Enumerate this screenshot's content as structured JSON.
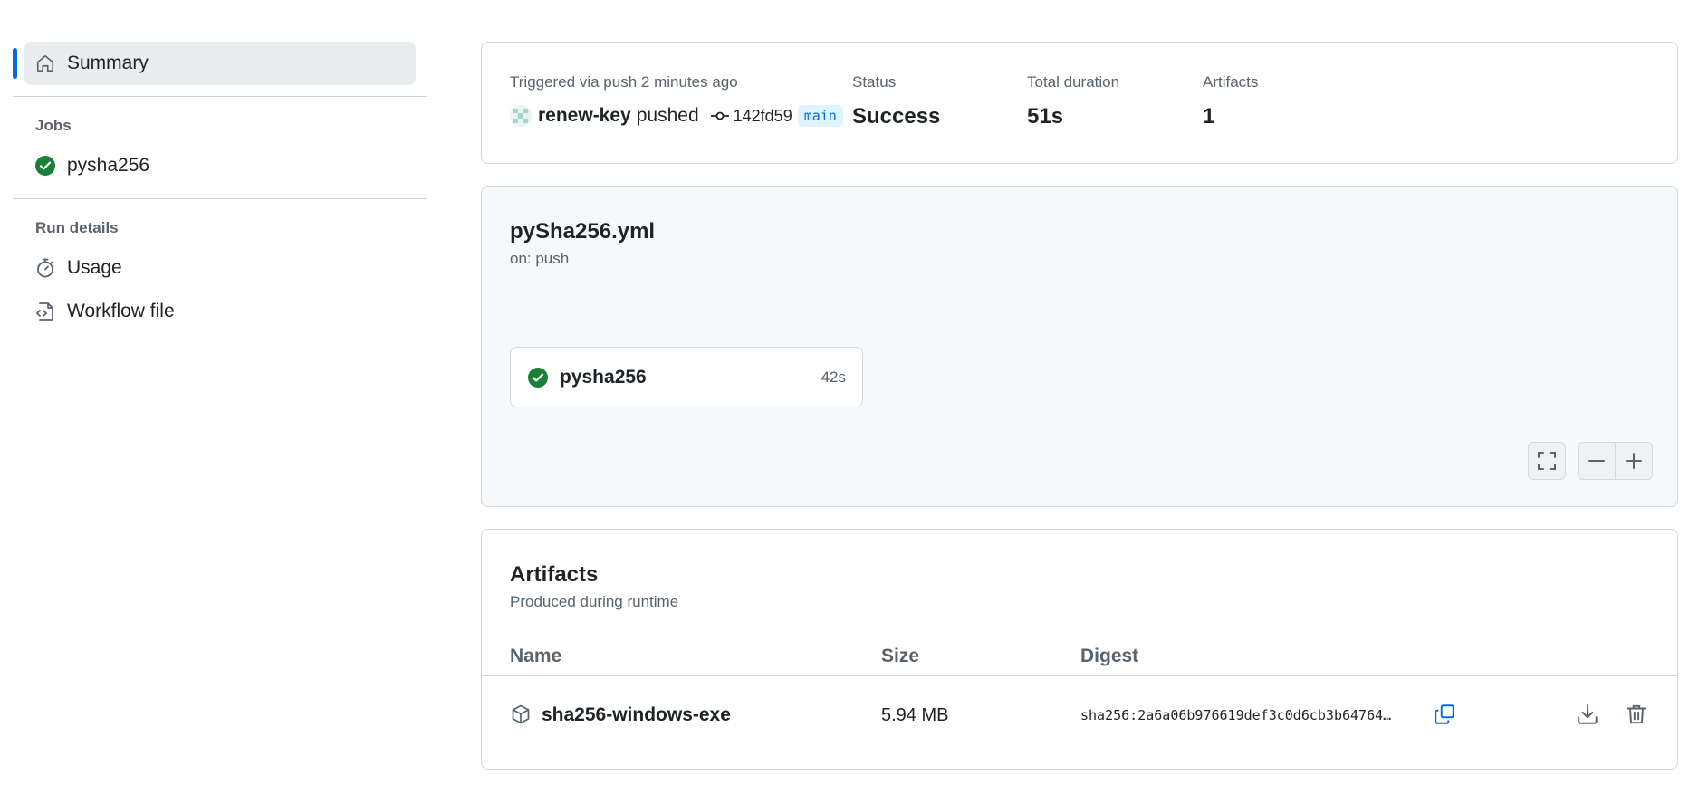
{
  "sidebar": {
    "summary_label": "Summary",
    "jobs_heading": "Jobs",
    "jobs": [
      {
        "label": "pysha256",
        "status": "success"
      }
    ],
    "run_details_heading": "Run details",
    "usage_label": "Usage",
    "workflow_file_label": "Workflow file"
  },
  "run": {
    "trigger_text": "Triggered via push 2 minutes ago",
    "actor": "renew-key",
    "action": "pushed",
    "commit": "142fd59",
    "branch": "main",
    "status_label": "Status",
    "status_value": "Success",
    "duration_label": "Total duration",
    "duration_value": "51s",
    "artifacts_label": "Artifacts",
    "artifacts_value": "1"
  },
  "workflow": {
    "file": "pySha256.yml",
    "trigger": "on: push",
    "job": {
      "name": "pysha256",
      "duration": "42s"
    }
  },
  "artifacts": {
    "title": "Artifacts",
    "subtitle": "Produced during runtime",
    "columns": {
      "name": "Name",
      "size": "Size",
      "digest": "Digest"
    },
    "items": [
      {
        "name": "sha256-windows-exe",
        "size": "5.94 MB",
        "digest": "sha256:2a6a06b976619def3c0d6cb3b64764…"
      }
    ]
  },
  "colors": {
    "accent": "#0969da",
    "success": "#1a7f37"
  }
}
